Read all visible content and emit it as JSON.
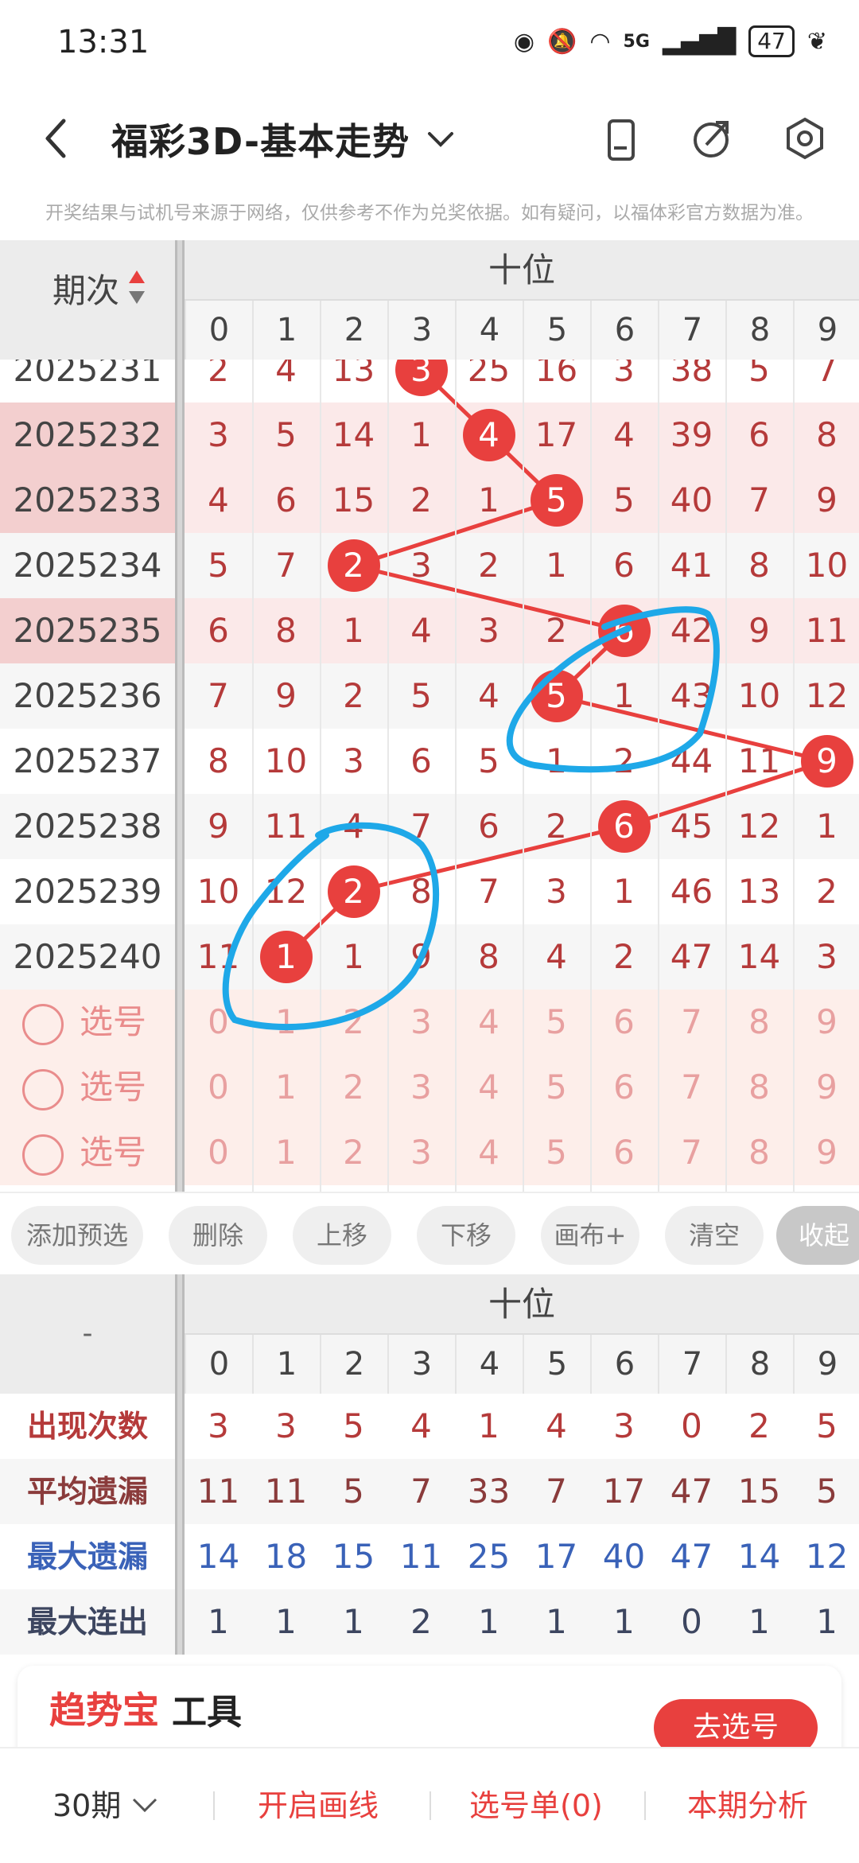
{
  "status_bar": {
    "time": "13:31",
    "network": "5G",
    "battery": "47"
  },
  "header": {
    "title": "福彩3D-基本走势"
  },
  "notice": "开奖结果与试机号来源于网络，仅供参考不作为兑奖依据。如有疑问，以福体彩官方数据为准。",
  "grid": {
    "period_header": "期次",
    "position_header": "十位",
    "digits": [
      "0",
      "1",
      "2",
      "3",
      "4",
      "5",
      "6",
      "7",
      "8",
      "9"
    ],
    "rows": [
      {
        "period": "2025231",
        "hit": 3,
        "values": [
          "2",
          "4",
          "13",
          "3",
          "25",
          "16",
          "3",
          "38",
          "5",
          "7"
        ]
      },
      {
        "period": "2025232",
        "hit": 4,
        "values": [
          "3",
          "5",
          "14",
          "1",
          "4",
          "17",
          "4",
          "39",
          "6",
          "8"
        ]
      },
      {
        "period": "2025233",
        "hit": 5,
        "values": [
          "4",
          "6",
          "15",
          "2",
          "1",
          "5",
          "5",
          "40",
          "7",
          "9"
        ]
      },
      {
        "period": "2025234",
        "hit": 2,
        "values": [
          "5",
          "7",
          "2",
          "3",
          "2",
          "1",
          "6",
          "41",
          "8",
          "10"
        ]
      },
      {
        "period": "2025235",
        "hit": 6,
        "values": [
          "6",
          "8",
          "1",
          "4",
          "3",
          "2",
          "6",
          "42",
          "9",
          "11"
        ]
      },
      {
        "period": "2025236",
        "hit": 5,
        "values": [
          "7",
          "9",
          "2",
          "5",
          "4",
          "5",
          "1",
          "43",
          "10",
          "12"
        ]
      },
      {
        "period": "2025237",
        "hit": 9,
        "values": [
          "8",
          "10",
          "3",
          "6",
          "5",
          "1",
          "2",
          "44",
          "11",
          "9"
        ]
      },
      {
        "period": "2025238",
        "hit": 6,
        "values": [
          "9",
          "11",
          "4",
          "7",
          "6",
          "2",
          "6",
          "45",
          "12",
          "1"
        ]
      },
      {
        "period": "2025239",
        "hit": 2,
        "values": [
          "10",
          "12",
          "2",
          "8",
          "7",
          "3",
          "1",
          "46",
          "13",
          "2"
        ]
      },
      {
        "period": "2025240",
        "hit": 1,
        "values": [
          "11",
          "1",
          "1",
          "9",
          "8",
          "4",
          "2",
          "47",
          "14",
          "3"
        ]
      }
    ],
    "pick_label": "选号",
    "pick_rows": 3
  },
  "toolbar": {
    "add": "添加预选",
    "delete": "删除",
    "up": "上移",
    "down": "下移",
    "canvas": "画布+",
    "clear": "清空",
    "collapse": "收起"
  },
  "stats": {
    "corner": "-",
    "position_header": "十位",
    "rows": [
      {
        "label": "出现次数",
        "color": "#b53a3a",
        "values": [
          "3",
          "3",
          "5",
          "4",
          "1",
          "4",
          "3",
          "0",
          "2",
          "5"
        ]
      },
      {
        "label": "平均遗漏",
        "color": "#8a3b3b",
        "values": [
          "11",
          "11",
          "5",
          "7",
          "33",
          "7",
          "17",
          "47",
          "15",
          "5"
        ]
      },
      {
        "label": "最大遗漏",
        "color": "#3a62b8",
        "values": [
          "14",
          "18",
          "15",
          "11",
          "25",
          "17",
          "40",
          "47",
          "14",
          "12"
        ]
      },
      {
        "label": "最大连出",
        "color": "#3d4660",
        "values": [
          "1",
          "1",
          "1",
          "2",
          "1",
          "1",
          "1",
          "0",
          "1",
          "1"
        ]
      }
    ]
  },
  "promo": {
    "brand": "趋势宝",
    "word": "工具",
    "button": "去选号"
  },
  "bottom_bar": {
    "periods": "30期",
    "draw_line": "开启画线",
    "pick_list": "选号单(0)",
    "analysis": "本期分析"
  },
  "colors": {
    "accent": "#e8403e",
    "annotation": "#1ea8e8",
    "highlight_row": "#f8d9d9"
  }
}
